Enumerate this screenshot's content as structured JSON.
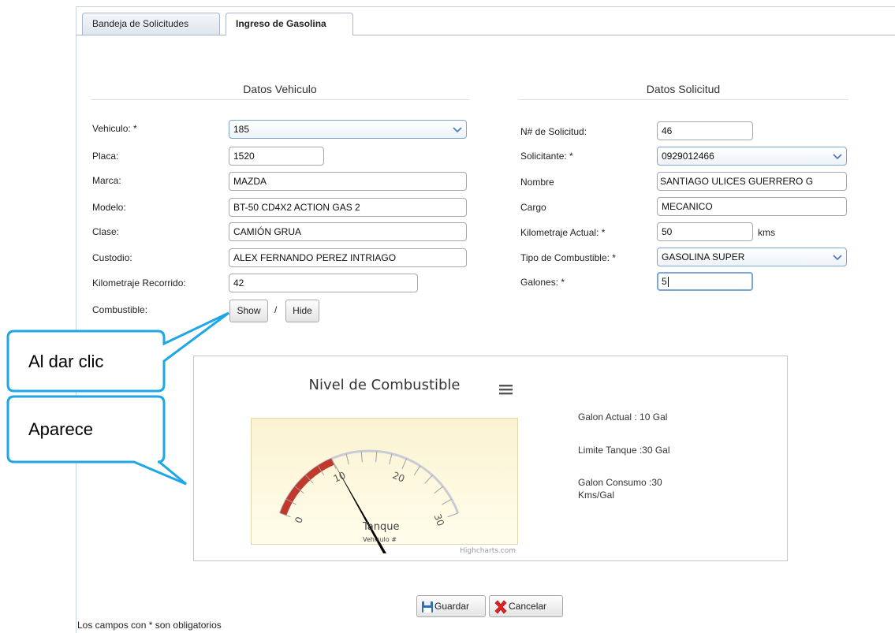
{
  "tabs": [
    {
      "label": "Bandeja de Solicitudes",
      "active": false
    },
    {
      "label": "Ingreso de Gasolina",
      "active": true
    }
  ],
  "vehiculo_section": {
    "title": "Datos Vehiculo",
    "fields": {
      "vehiculo": {
        "label": "Vehiculo: *",
        "value": "185"
      },
      "placa": {
        "label": "Placa:",
        "value": "1520"
      },
      "marca": {
        "label": "Marca:",
        "value": "MAZDA"
      },
      "modelo": {
        "label": "Modelo:",
        "value": "BT-50 CD4X2 ACTION GAS 2"
      },
      "clase": {
        "label": "Clase:",
        "value": "CAMIÓN GRUA"
      },
      "custodio": {
        "label": "Custodio:",
        "value": "ALEX FERNANDO PEREZ INTRIAGO"
      },
      "kilometraje_recorrido": {
        "label": "Kilometraje Recorrido:",
        "value": "42"
      },
      "combustible": {
        "label": "Combustible:",
        "show_label": "Show",
        "separator": "/",
        "hide_label": "Hide"
      }
    }
  },
  "solicitud_section": {
    "title": "Datos Solicitud",
    "fields": {
      "numero": {
        "label": "N# de Solicitud:",
        "value": "46"
      },
      "solicitante": {
        "label": "Solicitante: *",
        "value": "0929012466"
      },
      "nombre": {
        "label": "Nombre",
        "value": "SANTIAGO ULICES GUERRERO G"
      },
      "cargo": {
        "label": "Cargo",
        "value": "MECANICO"
      },
      "kilometraje_actual": {
        "label": "Kilometraje Actual: *",
        "value": "50",
        "unit": "kms"
      },
      "tipo_combustible": {
        "label": "Tipo de Combustible: *",
        "value": "GASOLINA SUPER"
      },
      "galones": {
        "label": "Galones: *",
        "value": "5"
      }
    }
  },
  "chart": {
    "title": "Nivel de Combustible",
    "pane_title": "Tanque",
    "pane_subtitle": "Vehiculo #",
    "credits": "Highcharts.com",
    "menu_icon": "hamburger-menu-icon",
    "info": {
      "galon_actual": "Galon Actual : 10 Gal",
      "limite_tanque": "Limite Tanque :30 Gal",
      "galon_consumo_1": "Galon Consumo :30",
      "galon_consumo_2": "Kms/Gal"
    }
  },
  "chart_data": {
    "type": "gauge",
    "title": "Nivel de Combustible",
    "min": 0,
    "max": 30,
    "tick_labels": [
      "0",
      "10",
      "20",
      "30"
    ],
    "value": 10,
    "plot_bands": [
      {
        "from": 0,
        "to": 10,
        "color": "#c0392b"
      }
    ],
    "colors": {
      "band": "#c0392b",
      "needle": "#000000",
      "background_top": "#fbf3d6",
      "background_bottom": "#fffce8"
    }
  },
  "actions": {
    "save_label": "Guardar",
    "cancel_label": "Cancelar",
    "save_icon": "floppy-disk-icon",
    "cancel_icon": "red-x-icon"
  },
  "footer_note": "Los campos con * son obligatorios",
  "callouts": {
    "first": "Al dar clic",
    "second": "Aparece"
  },
  "colors": {
    "callout_border": "#1ea7e6",
    "tab_border": "#aab7c6",
    "select_border": "#7fa6cf"
  }
}
